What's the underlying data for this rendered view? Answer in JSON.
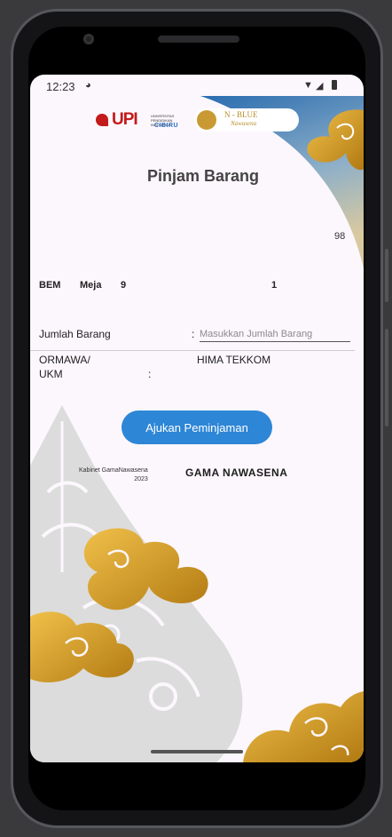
{
  "status_bar": {
    "time": "12:23"
  },
  "header": {
    "logo_upi": "UPI",
    "logo_upi_sub": "UNIVERSITAS PENDIDIKAN INDONESIA",
    "logo_cibiru": "CIBIRU",
    "logo_nblue": "N - BLUE",
    "logo_nawasena": "Nawasena"
  },
  "page": {
    "title": "Pinjam Barang",
    "counter": "98"
  },
  "item_row": {
    "org": "BEM",
    "item": "Meja",
    "stock": "9",
    "qty": "1"
  },
  "form": {
    "jumlah_label": "Jumlah Barang",
    "colon": ":",
    "jumlah_placeholder": "Masukkan Jumlah Barang",
    "ormawa_label_line1": "ORMAWA/",
    "ormawa_label_line2": "UKM",
    "ormawa_value": "HIMA TEKKOM"
  },
  "submit_label": "Ajukan Peminjaman",
  "footer": {
    "kabinet_line1": "Kabinet GamaNawasena",
    "kabinet_line2": "2023",
    "gama": "GAMA NAWASENA"
  },
  "colors": {
    "accent": "#2e86d6",
    "gold": "#d9a424",
    "blue_gradient": "#2a6db0"
  }
}
